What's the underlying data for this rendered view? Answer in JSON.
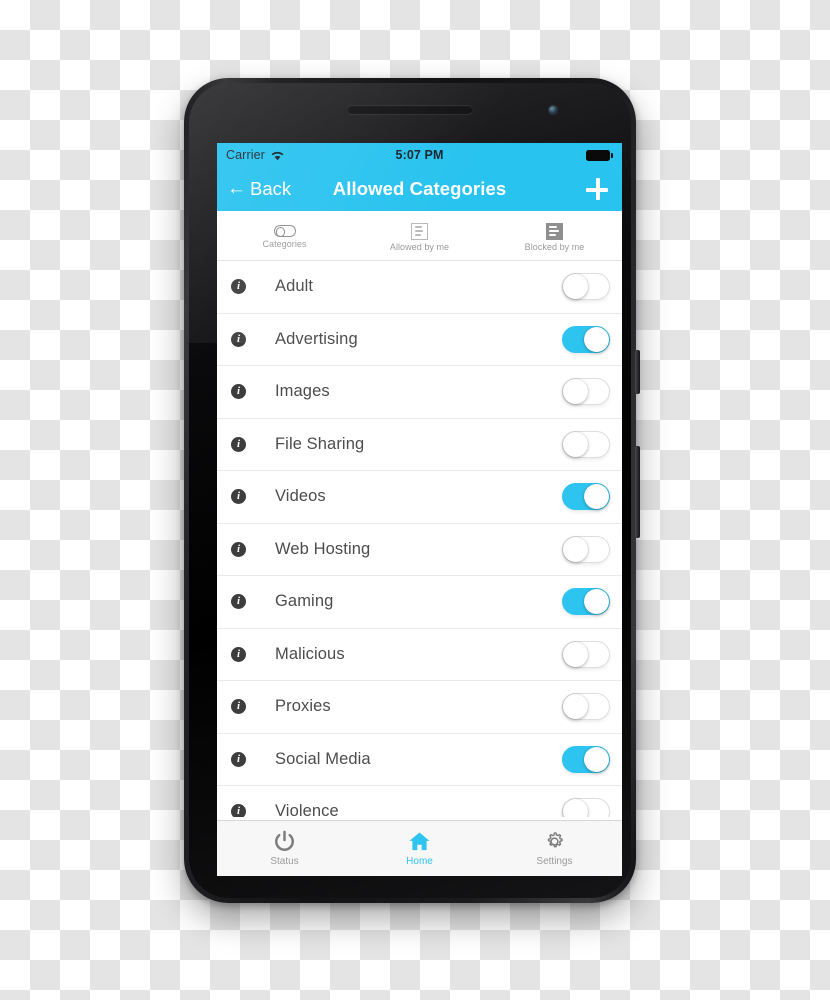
{
  "device": {
    "name": "smartphone-mockup",
    "earpiece": "earpiece-speaker",
    "front_camera": "front-camera",
    "bottom_speaker": "bottom-speaker"
  },
  "status_bar": {
    "carrier": "Carrier",
    "wifi_icon": "wifi-icon",
    "time": "5:07 PM",
    "battery_icon": "battery-full-icon"
  },
  "nav_bar": {
    "back_arrow": "←",
    "back_label": "Back",
    "title": "Allowed Categories",
    "add_icon": "plus-icon"
  },
  "segmented_tabs": [
    {
      "label": "Categories",
      "icon": "toggle-icon",
      "selected": true
    },
    {
      "label": "Allowed by me",
      "icon": "list-outline-icon",
      "selected": false
    },
    {
      "label": "Blocked by me",
      "icon": "list-filled-icon",
      "selected": false
    }
  ],
  "categories": [
    {
      "label": "Adult",
      "enabled": false
    },
    {
      "label": "Advertising",
      "enabled": true
    },
    {
      "label": "Images",
      "enabled": false
    },
    {
      "label": "File Sharing",
      "enabled": false
    },
    {
      "label": "Videos",
      "enabled": true
    },
    {
      "label": "Web Hosting",
      "enabled": false
    },
    {
      "label": "Gaming",
      "enabled": true
    },
    {
      "label": "Malicious",
      "enabled": false
    },
    {
      "label": "Proxies",
      "enabled": false
    },
    {
      "label": "Social Media",
      "enabled": true
    },
    {
      "label": "Violence",
      "enabled": false
    }
  ],
  "info_glyph": "i",
  "tab_bar": [
    {
      "label": "Status",
      "icon": "power-icon",
      "active": false
    },
    {
      "label": "Home",
      "icon": "home-icon",
      "active": true
    },
    {
      "label": "Settings",
      "icon": "gear-icon",
      "active": false
    }
  ],
  "colors": {
    "accent": "#29c3ef",
    "toggle_on": "#2ec4f0",
    "row_text": "#4c4c4c",
    "muted_text": "#9b9b9b"
  }
}
